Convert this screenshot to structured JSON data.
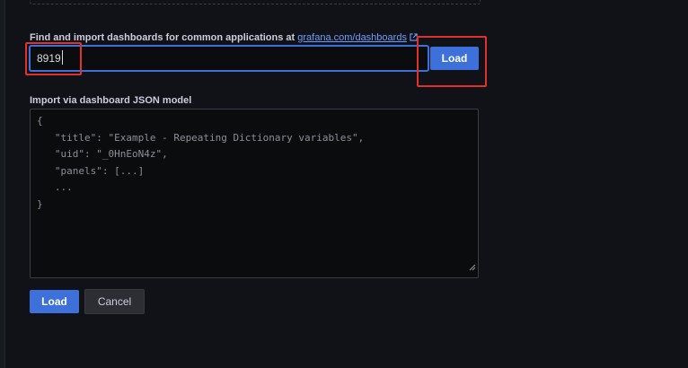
{
  "import_by_id": {
    "label_prefix": "Find and import dashboards for common applications at ",
    "link_text": "grafana.com/dashboards",
    "input_value": "8919",
    "load_label": "Load"
  },
  "import_json": {
    "label": "Import via dashboard JSON model",
    "lines": [
      "{",
      "   \"title\": \"Example - Repeating Dictionary variables\",",
      "   \"uid\": \"_0HnEoN4z\",",
      "   \"panels\": [...]",
      "   ...",
      "}"
    ]
  },
  "actions": {
    "load_label": "Load",
    "cancel_label": "Cancel"
  },
  "colors": {
    "background": "#111217",
    "primary": "#3d71d9",
    "link": "#6e9fff",
    "annotation_red": "#e0322d"
  }
}
